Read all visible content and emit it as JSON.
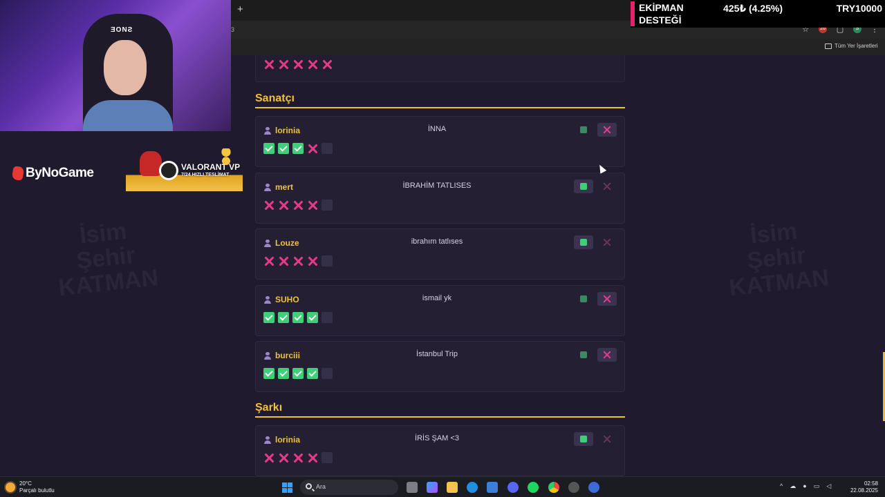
{
  "browser": {
    "new_tab_glyph": "+",
    "address_fragment": "3",
    "bookmarks_folder": "Tüm Yer İşaretleri",
    "extension_badge": "26",
    "profile_initial": "S"
  },
  "donation": {
    "label": "EKİPMAN DESTEĞİ",
    "amount": "425₺ (4.25%)",
    "goal": "TRY10000",
    "accent": "#e0246b"
  },
  "webcam": {
    "chair_logo": "ƎONƧ"
  },
  "sponsors": {
    "bynogame": "ByNoGame",
    "valorant_title": "VALORANT VP",
    "valorant_sub": "7/24 HIZLI TESLİMAT"
  },
  "watermark": {
    "lines": [
      "İsim",
      "Şehir",
      "KATMAN"
    ]
  },
  "colors": {
    "accent_yellow": "#f2c230",
    "ok_green": "#3ecf78",
    "no_pink": "#e6398a",
    "background": "#1f1a2e"
  },
  "top_card": {
    "votes": [
      "no",
      "no",
      "no",
      "no",
      "no"
    ]
  },
  "sections": [
    {
      "title": "Sanatçı",
      "entries": [
        {
          "user": "lorinia",
          "answer": "İNNA",
          "votes": [
            "ok",
            "ok",
            "ok",
            "no",
            "empty"
          ],
          "accept": "dim",
          "reject": "active"
        },
        {
          "user": "mert",
          "answer": "İBRAHİM TATLISES",
          "votes": [
            "no",
            "no",
            "no",
            "no",
            "empty"
          ],
          "accept": "active",
          "reject": "dim"
        },
        {
          "user": "Louze",
          "answer": "ibrahım tatlıses",
          "votes": [
            "no",
            "no",
            "no",
            "no",
            "empty"
          ],
          "accept": "active",
          "reject": "dim"
        },
        {
          "user": "SUHO",
          "answer": "ismail yk",
          "votes": [
            "ok",
            "ok",
            "ok",
            "ok",
            "empty"
          ],
          "accept": "dim",
          "reject": "active"
        },
        {
          "user": "burciii",
          "answer": "İstanbul Trip",
          "votes": [
            "ok",
            "ok",
            "ok",
            "ok",
            "empty"
          ],
          "accept": "dim",
          "reject": "active"
        }
      ]
    },
    {
      "title": "Şarkı",
      "entries": [
        {
          "user": "lorinia",
          "answer": "İRİS ŞAM <3",
          "votes": [
            "no",
            "no",
            "no",
            "no",
            "empty"
          ],
          "accept": "active",
          "reject": "dim"
        }
      ]
    }
  ],
  "taskbar": {
    "weather_temp": "20°C",
    "weather_desc": "Parçalı bulutlu",
    "search_placeholder": "Ara",
    "time": "02:58",
    "date": "22.08.2025"
  }
}
